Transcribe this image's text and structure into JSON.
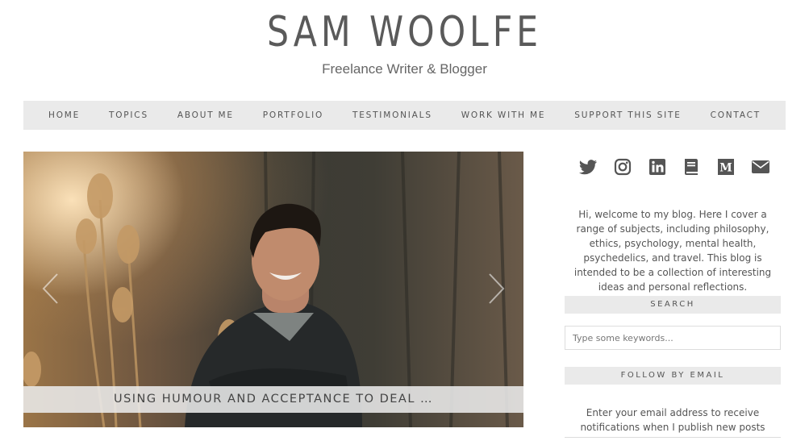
{
  "header": {
    "title": "SAM WOOLFE",
    "tagline": "Freelance Writer & Blogger"
  },
  "nav": {
    "items": [
      {
        "label": "HOME"
      },
      {
        "label": "TOPICS"
      },
      {
        "label": "ABOUT ME"
      },
      {
        "label": "PORTFOLIO"
      },
      {
        "label": "TESTIMONIALS"
      },
      {
        "label": "WORK WITH ME"
      },
      {
        "label": "SUPPORT THIS SITE"
      },
      {
        "label": "CONTACT"
      }
    ]
  },
  "slider": {
    "caption": "USING HUMOUR AND ACCEPTANCE TO DEAL …",
    "prev_icon": "chevron-left-icon",
    "next_icon": "chevron-right-icon"
  },
  "sidebar": {
    "social_icons": [
      "twitter-icon",
      "instagram-icon",
      "linkedin-icon",
      "book-icon",
      "medium-icon",
      "envelope-icon"
    ],
    "about": "Hi, welcome to my blog. Here I cover a range of subjects, including philosophy, ethics, psychology, mental health, psychedelics, and travel. This blog is intended to be a collection of interesting ideas and personal reflections.",
    "search": {
      "title": "SEARCH",
      "placeholder": "Type some keywords..."
    },
    "follow": {
      "title": "FOLLOW BY EMAIL",
      "text": "Enter your email address to receive notifications when I publish new posts"
    }
  },
  "colors": {
    "nav_bg": "#eaeaea",
    "text": "#555555",
    "icon": "#555555"
  }
}
